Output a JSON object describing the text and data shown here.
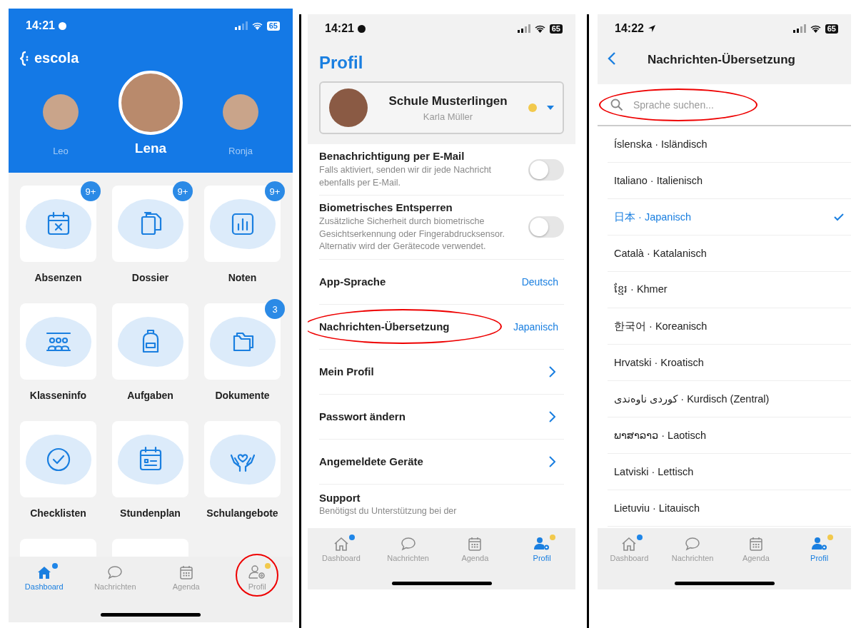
{
  "dashboard_screen": {
    "status_bar": {
      "time": "14:21",
      "recording_dot": true,
      "battery": "65"
    },
    "logo": "escola",
    "children": [
      {
        "name": "Leo",
        "selected": false
      },
      {
        "name": "Lena",
        "selected": true
      },
      {
        "name": "Ronja",
        "selected": false
      }
    ],
    "tiles": [
      {
        "kind": "tile",
        "label": "Absenzen",
        "badge": "9+"
      },
      {
        "kind": "tile",
        "label": "Dossier",
        "badge": "9+"
      },
      {
        "kind": "tile",
        "label": "Noten",
        "badge": "9+"
      },
      {
        "kind": "tile",
        "label": "Klasseninfo"
      },
      {
        "kind": "tile",
        "label": "Aufgaben"
      },
      {
        "kind": "tile",
        "label": "Dokumente",
        "badge": "3"
      },
      {
        "kind": "tile",
        "label": "Checklisten"
      },
      {
        "kind": "tile",
        "label": "Stundenplan"
      },
      {
        "kind": "tile",
        "label": "Schulangebote"
      },
      {
        "kind": "cut"
      },
      {
        "kind": "cut"
      }
    ],
    "tab_bar": [
      {
        "label": "Dashboard",
        "selected": true,
        "dot": {
          "color": "#1f86e8"
        }
      },
      {
        "label": "Nachrichten",
        "selected": false
      },
      {
        "label": "Agenda",
        "selected": false
      },
      {
        "label": "Profil",
        "selected": false,
        "annotated": true,
        "dot": {
          "color": "#f2c94c"
        }
      }
    ]
  },
  "profile_screen": {
    "status_bar": {
      "time": "14:21",
      "recording_dot": true,
      "battery": "65"
    },
    "title": "Profil",
    "school_card": {
      "name": "Schule Musterlingen",
      "user": "Karla Müller",
      "dot": {
        "color": "#f2c94c"
      }
    },
    "settings": [
      {
        "kind": "toggle",
        "title": "Benachrichtigung per E-Mail",
        "description": "Falls aktiviert, senden wir dir jede Nachricht ebenfalls per E-Mail.",
        "on": false
      },
      {
        "kind": "toggle",
        "title": "Biometrisches Entsperren",
        "description": "Zusätzliche Sicherheit durch biometrische Gesichtserkennung oder Fingerabdrucksensor. Alternativ wird der Gerätecode verwendet.",
        "on": false
      },
      {
        "kind": "value",
        "label": "App-Sprache",
        "value": "Deutsch"
      },
      {
        "kind": "value",
        "label": "Nachrichten-Übersetzung",
        "value": "Japanisch",
        "annotated": true
      },
      {
        "kind": "link",
        "label": "Mein Profil"
      },
      {
        "kind": "link",
        "label": "Passwort ändern"
      },
      {
        "kind": "link",
        "label": "Angemeldete Geräte"
      },
      {
        "kind": "text",
        "title": "Support",
        "description": "Benötigst du Unterstützung bei der"
      }
    ],
    "tab_bar": [
      {
        "label": "Dashboard",
        "selected": false,
        "dot": {
          "color": "#1f86e8"
        }
      },
      {
        "label": "Nachrichten",
        "selected": false
      },
      {
        "label": "Agenda",
        "selected": false
      },
      {
        "label": "Profil",
        "selected": true,
        "dot": {
          "color": "#f2c94c"
        }
      }
    ]
  },
  "translation_screen": {
    "status_bar": {
      "time": "14:22",
      "location_arrow": true,
      "battery": "65"
    },
    "title": "Nachrichten-Übersetzung",
    "search": {
      "placeholder": "Sprache suchen...",
      "annotated": true
    },
    "languages": [
      {
        "label": "Íslenska · Isländisch",
        "selected": false
      },
      {
        "label": "Italiano · Italienisch",
        "selected": false
      },
      {
        "label": "日本 · Japanisch",
        "selected": true
      },
      {
        "label": "Català · Katalanisch",
        "selected": false
      },
      {
        "label": "ខ្មែរ · Khmer",
        "selected": false
      },
      {
        "label": "한국어 · Koreanisch",
        "selected": false
      },
      {
        "label": "Hrvatski · Kroatisch",
        "selected": false
      },
      {
        "label": "کوردی ناوەندی · Kurdisch (Zentral)",
        "selected": false
      },
      {
        "label": "ພາສາລາວ · Laotisch",
        "selected": false
      },
      {
        "label": "Latviski · Lettisch",
        "selected": false
      },
      {
        "label": "Lietuviu · Litauisch",
        "selected": false
      }
    ],
    "tab_bar": [
      {
        "label": "Dashboard",
        "selected": false,
        "dot": {
          "color": "#1f86e8"
        }
      },
      {
        "label": "Nachrichten",
        "selected": false
      },
      {
        "label": "Agenda",
        "selected": false
      },
      {
        "label": "Profil",
        "selected": true,
        "dot": {
          "color": "#f2c94c"
        }
      }
    ]
  }
}
